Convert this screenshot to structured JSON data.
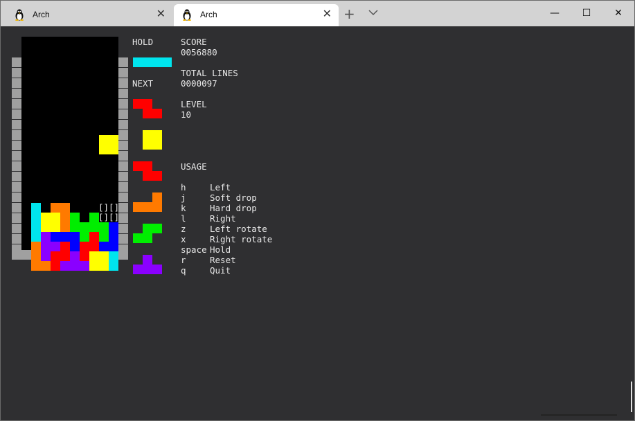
{
  "colors": {
    "I": "#00e5ee",
    "O": "#ffff00",
    "T": "#8a00ff",
    "S": "#00ee00",
    "Z": "#ff0000",
    "J": "#0000ff",
    "L": "#ff7a00",
    "wall": "#a0a0a0",
    "well": "#000000",
    "text": "#e8e8e8",
    "background": "#2f2f31"
  },
  "tabs": [
    {
      "title": "Arch",
      "icon": "tux-icon",
      "active": false
    },
    {
      "title": "Arch",
      "icon": "tux-icon",
      "active": true
    }
  ],
  "window_controls": {
    "minimize": "—",
    "maximize": "☐",
    "close": "✕",
    "new_tab": "+"
  },
  "game": {
    "hold_label": "HOLD",
    "hold_piece": "I",
    "next_label": "NEXT",
    "next_pieces": [
      "Z",
      "O",
      "Z",
      "L",
      "S",
      "T"
    ],
    "score_label": "SCORE",
    "score": "0056880",
    "lines_label": "TOTAL LINES",
    "lines": "0000097",
    "level_label": "LEVEL",
    "level": "10",
    "usage_label": "USAGE",
    "ghost_glyph": "[]",
    "usage": [
      {
        "key": "h",
        "action": "Left"
      },
      {
        "key": "j",
        "action": "Soft drop"
      },
      {
        "key": "k",
        "action": "Hard drop"
      },
      {
        "key": "l",
        "action": "Right"
      },
      {
        "key": "z",
        "action": "Left  rotate"
      },
      {
        "key": "x",
        "action": "Right rotate"
      },
      {
        "key": "space",
        "action": "Hold"
      },
      {
        "key": "r",
        "action": "Reset"
      },
      {
        "key": "q",
        "action": "Quit"
      }
    ],
    "board": [
      "..........",
      "..........",
      "..........",
      "..........",
      "..........",
      "..........",
      "..........",
      "..........",
      "..........",
      "..........",
      "..........",
      "..........",
      "..........",
      "..........",
      "..........",
      "..........",
      "..........",
      "..........",
      "..........",
      "..........",
      "..........",
      "..........",
      "..........",
      "..........",
      "..........",
      "..........",
      "..........",
      "..........",
      "..........",
      "..........",
      "..........",
      "..........",
      "..........",
      "..........",
      "..........",
      "..........",
      "..........",
      "..........",
      "..........",
      ".........."
    ],
    "cells": [
      [
        0,
        0,
        0,
        0,
        0,
        0,
        0,
        0,
        0,
        0
      ],
      [
        0,
        0,
        0,
        0,
        0,
        0,
        0,
        0,
        0,
        0
      ],
      [
        0,
        0,
        0,
        0,
        0,
        0,
        0,
        0,
        0,
        0
      ],
      [
        0,
        0,
        0,
        0,
        0,
        0,
        0,
        0,
        0,
        0
      ],
      [
        0,
        0,
        0,
        0,
        0,
        0,
        0,
        0,
        0,
        0
      ],
      [
        0,
        0,
        0,
        0,
        0,
        0,
        0,
        0,
        0,
        0
      ],
      [
        0,
        0,
        0,
        0,
        0,
        0,
        0,
        0,
        0,
        0
      ],
      [
        0,
        0,
        0,
        0,
        0,
        0,
        0,
        0,
        0,
        0
      ],
      [
        0,
        0,
        0,
        0,
        0,
        0,
        0,
        0,
        "O",
        "O"
      ],
      [
        0,
        0,
        0,
        0,
        0,
        0,
        0,
        0,
        "O",
        "O"
      ],
      [
        0,
        0,
        0,
        0,
        0,
        0,
        0,
        0,
        0,
        0
      ],
      [
        0,
        0,
        0,
        0,
        0,
        0,
        0,
        0,
        0,
        0
      ],
      [
        0,
        0,
        0,
        0,
        0,
        0,
        0,
        0,
        0,
        0
      ],
      [
        0,
        0,
        0,
        0,
        0,
        0,
        0,
        0,
        0,
        0
      ],
      [
        0,
        0,
        0,
        0,
        0,
        0,
        0,
        0,
        0,
        0
      ],
      [
        0,
        "I",
        0,
        "L",
        "L",
        0,
        0,
        0,
        "G",
        "G"
      ],
      [
        0,
        "I",
        "O",
        "O",
        "L",
        "S",
        0,
        "S",
        "G",
        "G"
      ],
      [
        0,
        "I",
        "O",
        "O",
        "L",
        "S",
        "S",
        "S",
        "S",
        "J"
      ],
      [
        0,
        "I",
        "T",
        "J",
        "J",
        "J",
        "S",
        "Z",
        "S",
        "J"
      ],
      [
        0,
        "L",
        "T",
        "T",
        "Z",
        "J",
        "Z",
        "Z",
        "J",
        "J"
      ],
      [
        0,
        "L",
        "T",
        "Z",
        "Z",
        "T",
        "Z",
        "O",
        "O",
        "I"
      ],
      [
        0,
        "L",
        "L",
        "Z",
        "T",
        "T",
        "T",
        "O",
        "O",
        "I"
      ]
    ]
  }
}
